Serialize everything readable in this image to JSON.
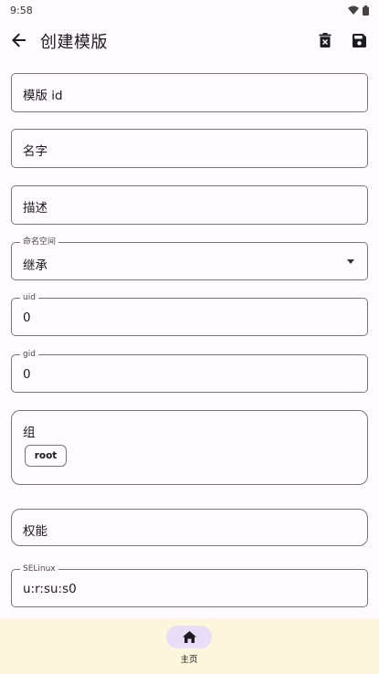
{
  "status_bar": {
    "time": "9:58"
  },
  "app_bar": {
    "title": "创建模版"
  },
  "fields": {
    "template_id": {
      "placeholder": "模版 id"
    },
    "name": {
      "placeholder": "名字"
    },
    "description": {
      "placeholder": "描述"
    },
    "namespace": {
      "label": "命名空间",
      "value": "继承"
    },
    "uid": {
      "label": "uid",
      "value": "0"
    },
    "gid": {
      "label": "gid",
      "value": "0"
    },
    "groups": {
      "title": "组",
      "chips": [
        "root"
      ]
    },
    "capabilities": {
      "placeholder": "权能"
    },
    "selinux": {
      "label": "SELinux",
      "value": "u:r:su:s0"
    }
  },
  "bottom_nav": {
    "items": [
      {
        "label": "主页",
        "icon": "home-icon",
        "selected": true
      }
    ]
  },
  "colors": {
    "background": "#FFFBFE",
    "outline": "#79747E",
    "nav_background": "#FCF6DC",
    "nav_indicator": "#E8DEF8"
  }
}
